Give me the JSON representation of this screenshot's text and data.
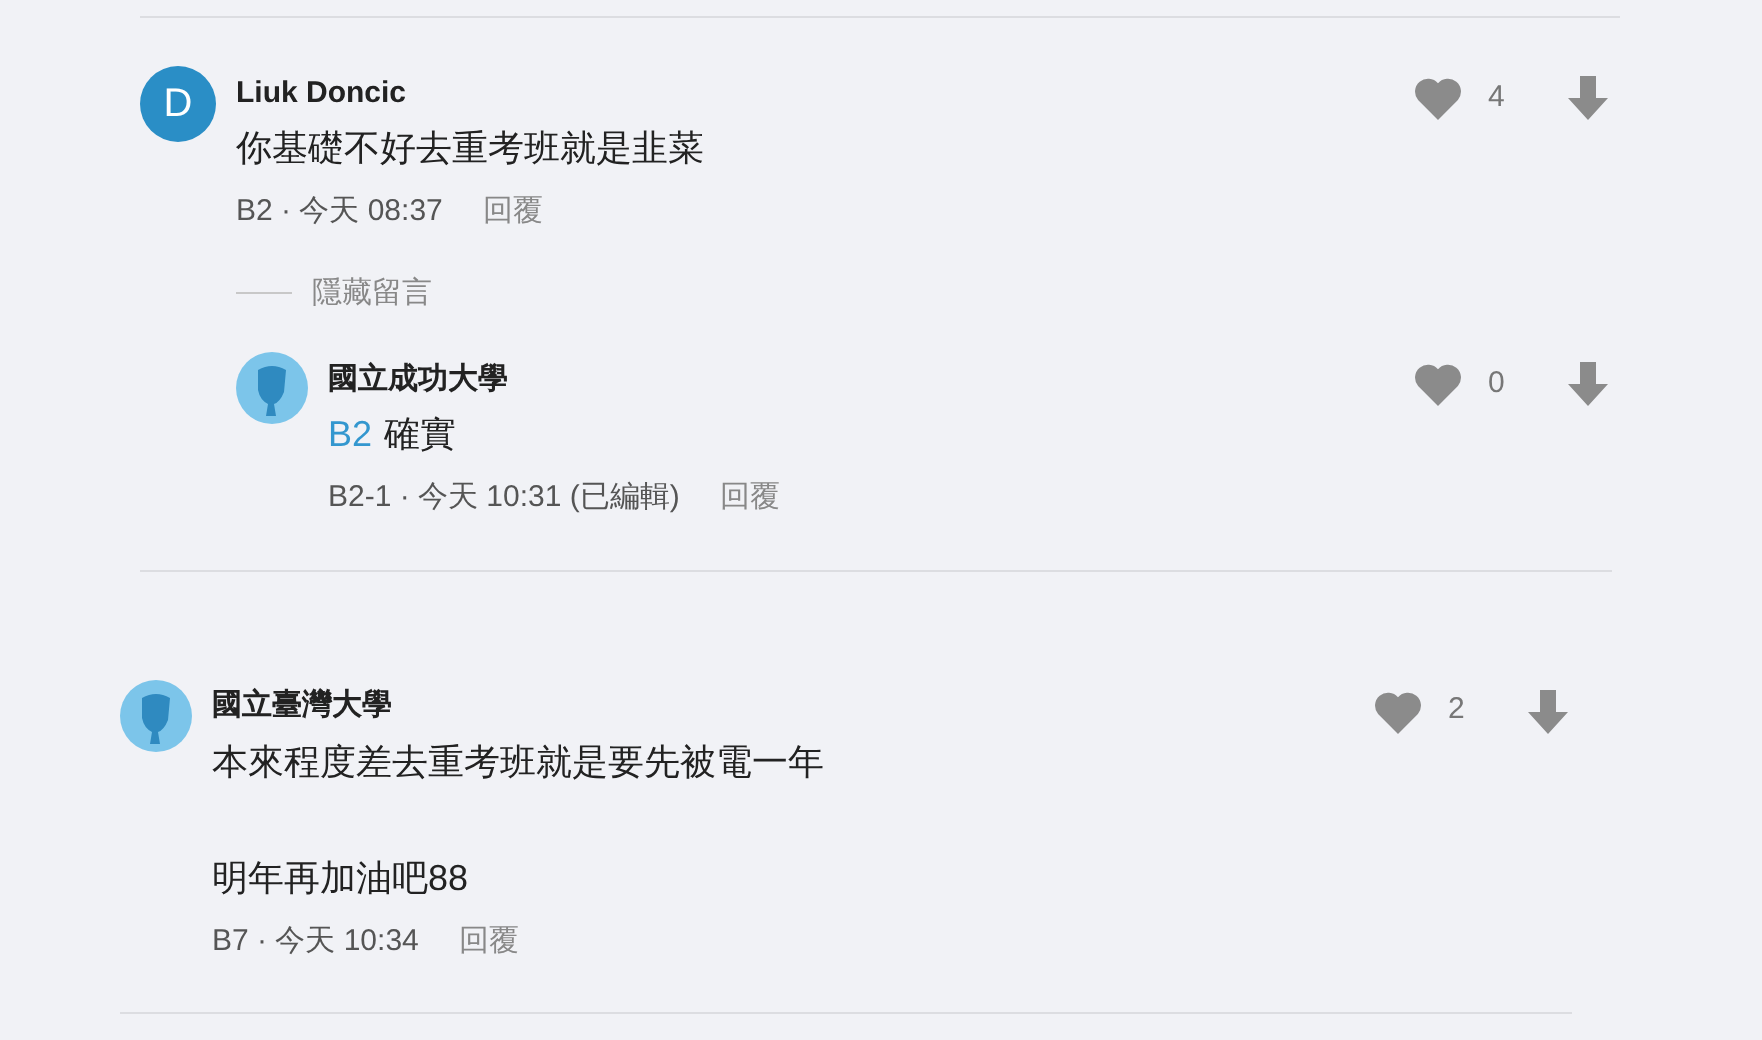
{
  "comments": [
    {
      "avatar": {
        "kind": "letter",
        "letter": "D"
      },
      "name": "Liuk Doncic",
      "paragraphs": [
        {
          "text": "你基礎不好去重考班就是韭菜"
        }
      ],
      "meta": "B2 · 今天 08:37",
      "reply_label": "回覆",
      "likes": "4",
      "hide_label": "隱藏留言",
      "replies": [
        {
          "avatar": {
            "kind": "silhouette"
          },
          "name": "國立成功大學",
          "paragraphs": [
            {
              "mention": "B2",
              "text": "確實"
            }
          ],
          "meta": "B2-1 · 今天 10:31 (已編輯)",
          "reply_label": "回覆",
          "likes": "0"
        }
      ]
    },
    {
      "avatar": {
        "kind": "silhouette"
      },
      "name": "國立臺灣大學",
      "paragraphs": [
        {
          "text": "本來程度差去重考班就是要先被電一年"
        },
        {
          "text": "明年再加油吧88"
        }
      ],
      "meta": "B7 · 今天 10:34",
      "reply_label": "回覆",
      "likes": "2"
    }
  ]
}
